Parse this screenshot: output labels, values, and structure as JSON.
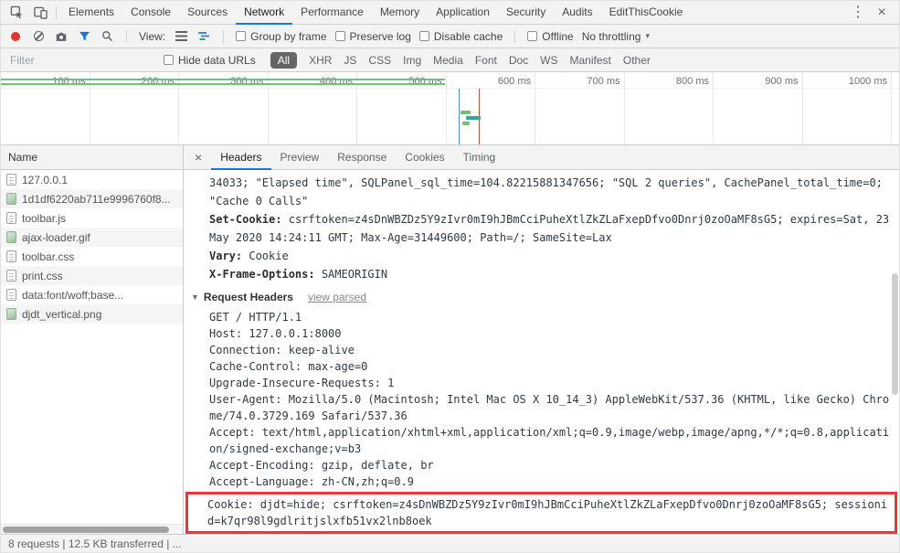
{
  "devtools": {
    "main_tabs": [
      "Elements",
      "Console",
      "Sources",
      "Network",
      "Performance",
      "Memory",
      "Application",
      "Security",
      "Audits",
      "EditThisCookie"
    ],
    "active_main_tab": "Network",
    "menu_icon": "⋮",
    "close_icon": "×"
  },
  "network_toolbar": {
    "view_label": "View:",
    "checkbox_group_by_frame": "Group by frame",
    "checkbox_preserve_log": "Preserve log",
    "checkbox_disable_cache": "Disable cache",
    "checkbox_offline": "Offline",
    "throttling_value": "No throttling",
    "throttling_caret": "▾"
  },
  "filter_bar": {
    "filter_placeholder": "Filter",
    "hide_data_urls_label": "Hide data URLs",
    "type_filters": [
      "All",
      "XHR",
      "JS",
      "CSS",
      "Img",
      "Media",
      "Font",
      "Doc",
      "WS",
      "Manifest",
      "Other"
    ],
    "active_type": "All"
  },
  "timeline": {
    "ticks": [
      "100 ms",
      "200 ms",
      "300 ms",
      "400 ms",
      "500 ms",
      "600 ms",
      "700 ms",
      "800 ms",
      "900 ms",
      "1000 ms"
    ]
  },
  "request_list": {
    "column_header": "Name",
    "rows": [
      {
        "name": "127.0.0.1",
        "type": "document"
      },
      {
        "name": "1d1df6220ab711e9996760f8...",
        "type": "image"
      },
      {
        "name": "toolbar.js",
        "type": "script"
      },
      {
        "name": "ajax-loader.gif",
        "type": "image"
      },
      {
        "name": "toolbar.css",
        "type": "stylesheet"
      },
      {
        "name": "print.css",
        "type": "stylesheet"
      },
      {
        "name": "data:font/woff;base...",
        "type": "font"
      },
      {
        "name": "djdt_vertical.png",
        "type": "image"
      }
    ]
  },
  "details": {
    "close_icon": "×",
    "tabs": [
      "Headers",
      "Preview",
      "Response",
      "Cookies",
      "Timing"
    ],
    "active_tab": "Headers",
    "scrolled_value_tail": "34033; \"Elapsed time\", SQLPanel_sql_time=104.82215881347656; \"SQL 2 queries\", CachePanel_total_time=0; \"Cache 0 Calls\"",
    "response_headers": [
      {
        "name": "Set-Cookie:",
        "value": "csrftoken=z4sDnWBZDz5Y9zIvr0mI9hJBmCciPuheXtlZkZLaFxepDfvo0Dnrj0zoOaMF8sG5; expires=Sat, 23 May 2020 14:24:11 GMT; Max-Age=31449600; Path=/; SameSite=Lax"
      },
      {
        "name": "Vary:",
        "value": "Cookie"
      },
      {
        "name": "X-Frame-Options:",
        "value": "SAMEORIGIN"
      }
    ],
    "request_headers_section": {
      "disclosure_icon": "▼",
      "title": "Request Headers",
      "view_parsed_label": "view parsed"
    },
    "raw_request_headers": [
      "GET / HTTP/1.1",
      "Host: 127.0.0.1:8000",
      "Connection: keep-alive",
      "Cache-Control: max-age=0",
      "Upgrade-Insecure-Requests: 1",
      "User-Agent: Mozilla/5.0 (Macintosh; Intel Mac OS X 10_14_3) AppleWebKit/537.36 (KHTML, like Gecko) Chrome/74.0.3729.169 Safari/537.36",
      "Accept: text/html,application/xhtml+xml,application/xml;q=0.9,image/webp,image/apng,*/*;q=0.8,application/signed-exchange;v=b3",
      "Accept-Encoding: gzip, deflate, br",
      "Accept-Language: zh-CN,zh;q=0.9"
    ],
    "highlighted_request_header": "Cookie: djdt=hide; csrftoken=z4sDnWBZDz5Y9zIvr0mI9hJBmCciPuheXtlZkZLaFxepDfvo0Dnrj0zoOaMF8sG5; sessionid=k7qr98l9gdlritjslxfb51vx2lnb8oek"
  },
  "status_bar": {
    "summary": "8 requests  |  12.5 KB transferred  |  ..."
  },
  "colors": {
    "accent_blue": "#1a73e8",
    "record_red": "#e0342f",
    "highlight_box_red": "#e53935",
    "overview_green": "#74bf74"
  }
}
